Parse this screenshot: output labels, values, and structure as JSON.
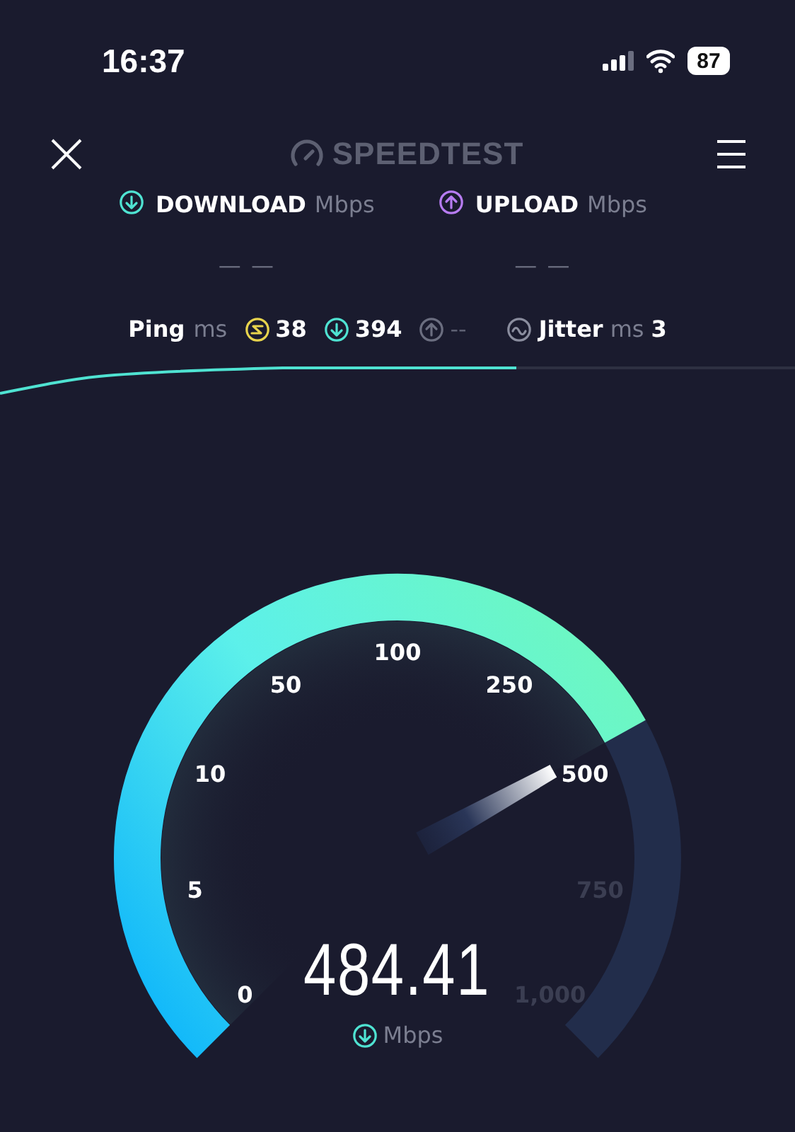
{
  "status_bar": {
    "time": "16:37",
    "battery": "87"
  },
  "header": {
    "logo": "SPEEDTEST"
  },
  "results": [
    {
      "kind": "download",
      "label": "DOWNLOAD",
      "unit": "Mbps",
      "value": "— —"
    },
    {
      "kind": "upload",
      "label": "UPLOAD",
      "unit": "Mbps",
      "value": "— —"
    }
  ],
  "ping": {
    "label": "Ping",
    "unit": "ms",
    "readings": [
      {
        "kind": "idle",
        "value": "38"
      },
      {
        "kind": "download",
        "value": "394"
      },
      {
        "kind": "upload",
        "value": "--"
      }
    ]
  },
  "jitter": {
    "label": "Jitter",
    "unit": "ms",
    "value": "3"
  },
  "gauge": {
    "ticks": [
      {
        "label": "0",
        "active": true
      },
      {
        "label": "5",
        "active": true
      },
      {
        "label": "10",
        "active": true
      },
      {
        "label": "50",
        "active": true
      },
      {
        "label": "100",
        "active": true
      },
      {
        "label": "250",
        "active": true
      },
      {
        "label": "500",
        "active": true
      },
      {
        "label": "750",
        "active": false
      },
      {
        "label": "1,000",
        "active": false
      }
    ],
    "value": "484.41",
    "unit": "Mbps"
  }
}
